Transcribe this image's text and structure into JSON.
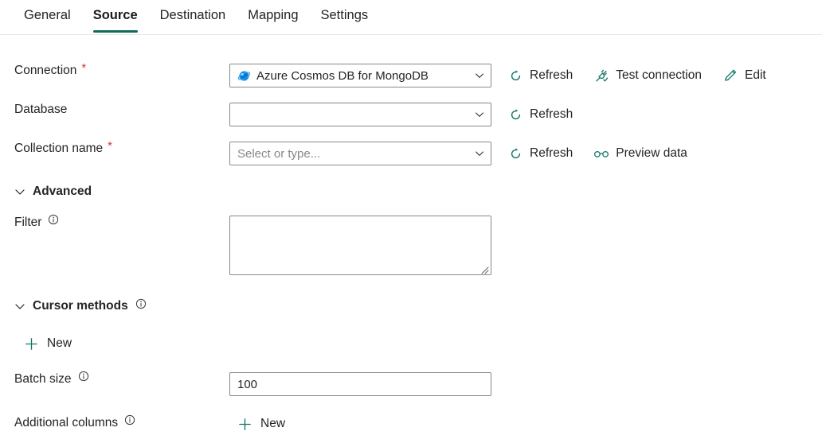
{
  "tabs": [
    {
      "label": "General",
      "active": false
    },
    {
      "label": "Source",
      "active": true
    },
    {
      "label": "Destination",
      "active": false
    },
    {
      "label": "Mapping",
      "active": false
    },
    {
      "label": "Settings",
      "active": false
    }
  ],
  "colors": {
    "accent_underline": "#0f6c5c",
    "icon_teal": "#117865",
    "required_red": "#d13438",
    "border": "#8a8886",
    "text": "#242424",
    "placeholder": "#8a8886"
  },
  "form": {
    "connection": {
      "label": "Connection",
      "required": true,
      "value": "Azure Cosmos DB for MongoDB",
      "icon": "azure-cosmos-db-icon",
      "commands": [
        {
          "label": "Refresh",
          "icon": "refresh-icon"
        },
        {
          "label": "Test connection",
          "icon": "plug-check-icon"
        },
        {
          "label": "Edit",
          "icon": "pencil-icon"
        }
      ]
    },
    "database": {
      "label": "Database",
      "required": false,
      "value": "",
      "placeholder": "",
      "commands": [
        {
          "label": "Refresh",
          "icon": "refresh-icon"
        }
      ]
    },
    "collection": {
      "label": "Collection name",
      "required": true,
      "value": "",
      "placeholder": "Select or type...",
      "commands": [
        {
          "label": "Refresh",
          "icon": "refresh-icon"
        },
        {
          "label": "Preview data",
          "icon": "eyeglasses-icon"
        }
      ]
    },
    "advanced_section": {
      "label": "Advanced",
      "expanded": true,
      "chevron": "chevron-down-icon"
    },
    "filter": {
      "label": "Filter",
      "info": true,
      "value": ""
    },
    "cursor_methods_section": {
      "label": "Cursor methods",
      "expanded": true,
      "chevron": "chevron-down-icon",
      "info": true,
      "new_label": "New"
    },
    "batch_size": {
      "label": "Batch size",
      "info": true,
      "value": "100"
    },
    "additional_columns": {
      "label": "Additional columns",
      "info": true,
      "new_label": "New"
    }
  }
}
